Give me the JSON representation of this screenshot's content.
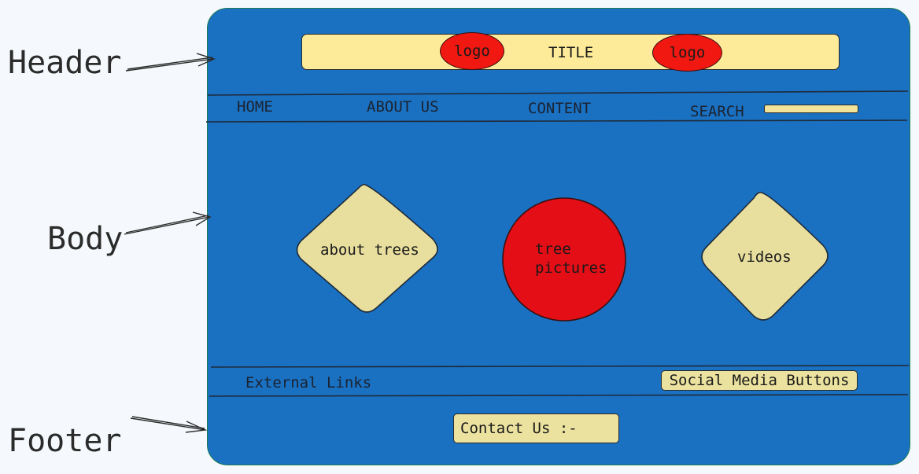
{
  "annotations": {
    "header": "Header",
    "body": "Body",
    "footer": "Footer"
  },
  "header": {
    "title": "TITLE",
    "logo_left": "logo",
    "logo_right": "logo"
  },
  "nav": {
    "items": [
      "HOME",
      "ABOUT US",
      "CONTENT",
      "SEARCH"
    ]
  },
  "body": {
    "left_tile": "about trees",
    "center_tile_line1": "tree",
    "center_tile_line2": "pictures",
    "right_tile": "videos"
  },
  "footer": {
    "external_links": "External Links",
    "social_button": "Social Media Buttons",
    "contact_button": "Contact Us :-"
  },
  "colors": {
    "frame": "#1a70c1",
    "title_bar": "#fdeb9a",
    "logo": "#f01810",
    "tile": "#e8df9e",
    "circle": "#e40e16"
  }
}
